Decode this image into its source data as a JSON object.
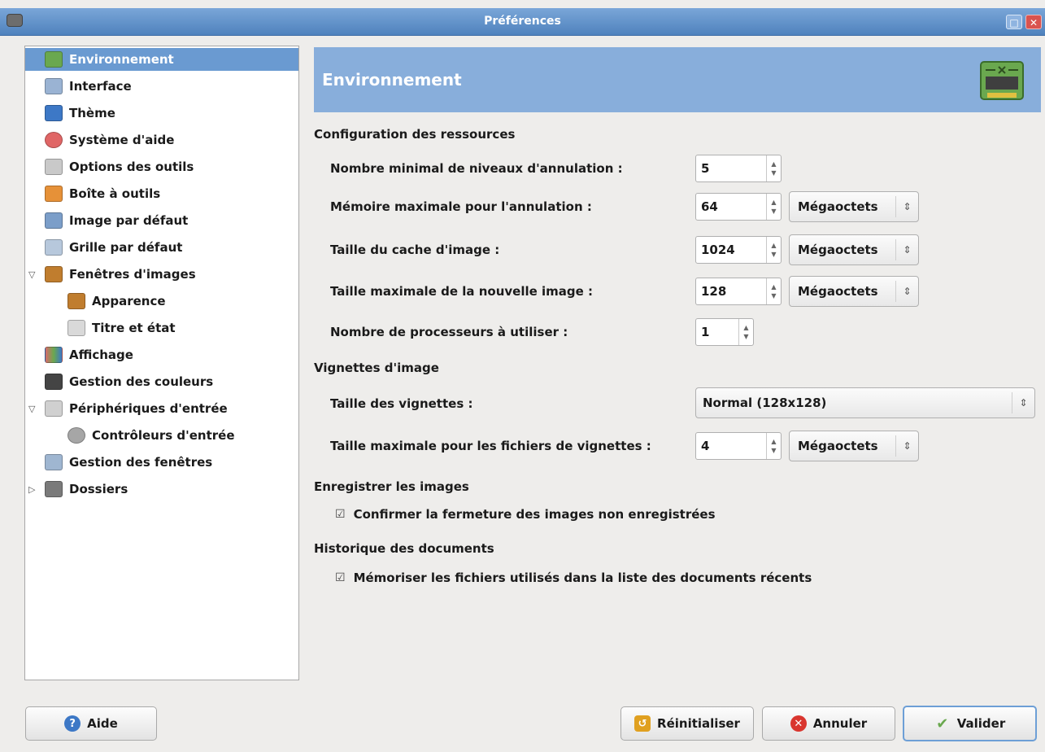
{
  "window": {
    "title": "Préférences"
  },
  "sidebar": {
    "items": [
      {
        "label": "Environnement",
        "color": "#6aa84f"
      },
      {
        "label": "Interface",
        "color": "#9ab3d3"
      },
      {
        "label": "Thème",
        "color": "#3d78c6"
      },
      {
        "label": "Système d'aide",
        "color": "#e06666"
      },
      {
        "label": "Options des outils",
        "color": "#c9c9c9"
      },
      {
        "label": "Boîte à outils",
        "color": "#e69138"
      },
      {
        "label": "Image par défaut",
        "color": "#7b9ec9"
      },
      {
        "label": "Grille par défaut",
        "color": "#b7c8dc"
      },
      {
        "label": "Fenêtres d'images",
        "color": "#c07d2e"
      },
      {
        "label": "Apparence",
        "color": "#c07d2e"
      },
      {
        "label": "Titre et état",
        "color": "#d9d9d9"
      },
      {
        "label": "Affichage",
        "color": "#d66b6b"
      },
      {
        "label": "Gestion des couleurs",
        "color": "#444444"
      },
      {
        "label": "Périphériques d'entrée",
        "color": "#d0d0d0"
      },
      {
        "label": "Contrôleurs d'entrée",
        "color": "#a6a6a6"
      },
      {
        "label": "Gestion des fenêtres",
        "color": "#9fb6d1"
      },
      {
        "label": "Dossiers",
        "color": "#7a7a7a"
      }
    ]
  },
  "header": {
    "title": "Environnement"
  },
  "sections": {
    "resources": "Configuration des ressources",
    "thumbnails": "Vignettes d'image",
    "save": "Enregistrer les images",
    "history": "Historique des documents"
  },
  "fields": {
    "undo_levels": {
      "label": "Nombre minimal de niveaux d'annulation :",
      "value": "5"
    },
    "undo_memory": {
      "label": "Mémoire maximale pour l'annulation :",
      "value": "64",
      "unit": "Mégaoctets"
    },
    "cache": {
      "label": "Taille du cache d'image :",
      "value": "1024",
      "unit": "Mégaoctets"
    },
    "max_new": {
      "label": "Taille maximale de la nouvelle image :",
      "value": "128",
      "unit": "Mégaoctets"
    },
    "processors": {
      "label": "Nombre de processeurs à utiliser :",
      "value": "1"
    },
    "thumb_size": {
      "label": "Taille des vignettes :",
      "value": "Normal (128x128)"
    },
    "thumb_max": {
      "label": "Taille maximale pour les fichiers de vignettes :",
      "value": "4",
      "unit": "Mégaoctets"
    }
  },
  "checks": {
    "confirm_close": {
      "label": "Confirmer la fermeture des images non enregistrées",
      "checked": true
    },
    "remember_files": {
      "label": "Mémoriser les fichiers utilisés dans la liste des documents récents",
      "checked": true
    }
  },
  "buttons": {
    "help": "Aide",
    "reset": "Réinitialiser",
    "cancel": "Annuler",
    "ok": "Valider"
  }
}
